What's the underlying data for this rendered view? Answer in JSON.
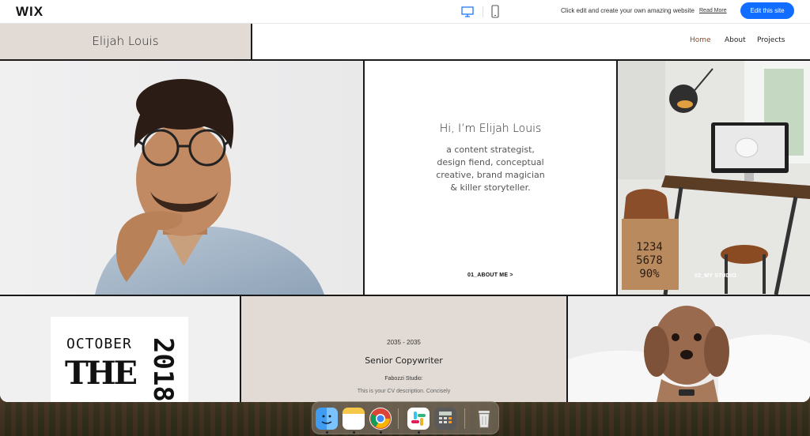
{
  "topbar": {
    "logo": "WIX",
    "message": "Click edit and create your own amazing website",
    "read_more": "Read More",
    "edit_button": "Edit this site",
    "accent": "#116dff"
  },
  "site": {
    "brand": "Elijah Louis",
    "nav": [
      "Home",
      "About",
      "Projects"
    ],
    "active_nav": "Home"
  },
  "intro": {
    "title": "Hi, I’m Elijah Louis",
    "lines": [
      "a content strategist,",
      "design fiend, conceptual",
      "creative, brand magician",
      "& killer storyteller."
    ],
    "about_link": "01_ABOUT ME  >"
  },
  "studio": {
    "label": "02_MY STUDIO"
  },
  "poster": {
    "word": "OCTOBER",
    "the": "THE",
    "year": "2018"
  },
  "experience": {
    "years": "2035 - 2035",
    "role": "Senior Copywriter",
    "company": "Fabozzi Studio:",
    "description": "This is your CV description. Concisely"
  },
  "dock": {
    "apps": [
      "finder-icon",
      "notes-icon",
      "chrome-icon",
      "slack-icon",
      "calculator-icon",
      "trash-icon"
    ]
  }
}
